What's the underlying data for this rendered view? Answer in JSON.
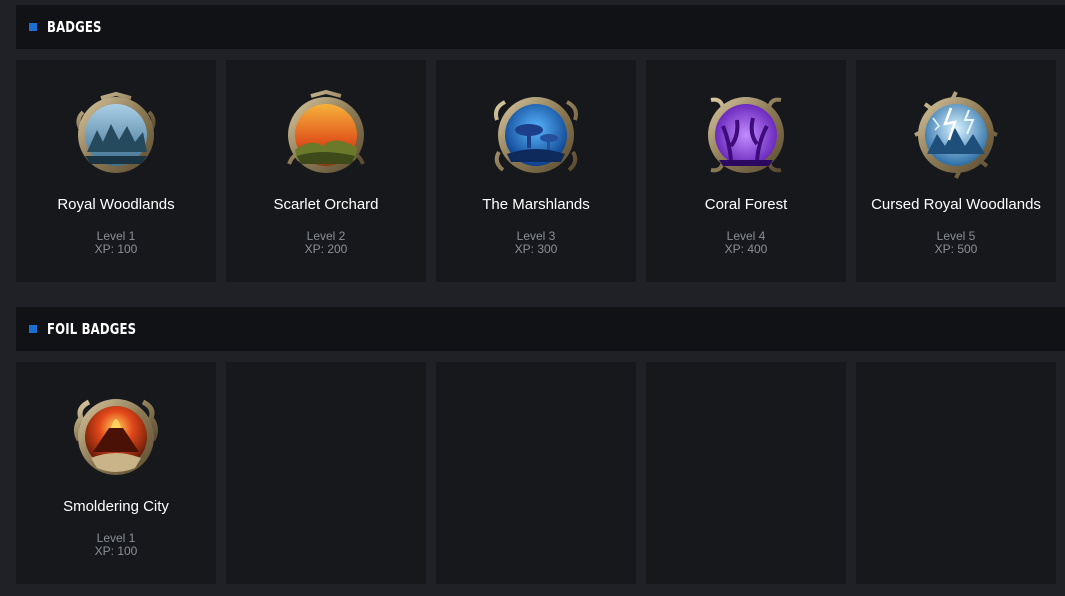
{
  "sections": [
    {
      "title": "BADGES",
      "badges": [
        {
          "name": "Royal Woodlands",
          "level": "Level 1",
          "xp": "XP: 100",
          "icon": "pine-forest-badge-icon"
        },
        {
          "name": "Scarlet Orchard",
          "level": "Level 2",
          "xp": "XP: 200",
          "icon": "sunset-hills-badge-icon"
        },
        {
          "name": "The Marshlands",
          "level": "Level 3",
          "xp": "XP: 300",
          "icon": "mushroom-swamp-badge-icon"
        },
        {
          "name": "Coral Forest",
          "level": "Level 4",
          "xp": "XP: 400",
          "icon": "purple-coral-badge-icon"
        },
        {
          "name": "Cursed Royal Woodlands",
          "level": "Level 5",
          "xp": "XP: 500",
          "icon": "lightning-forest-badge-icon"
        }
      ]
    },
    {
      "title": "FOIL BADGES",
      "badges": [
        {
          "name": "Smoldering City",
          "level": "Level 1",
          "xp": "XP: 100",
          "icon": "volcano-badge-icon"
        }
      ]
    }
  ],
  "colors": {
    "accent": "#1c6fd1",
    "background": "#1f2126",
    "header": "#111215",
    "card": "#16181c"
  }
}
